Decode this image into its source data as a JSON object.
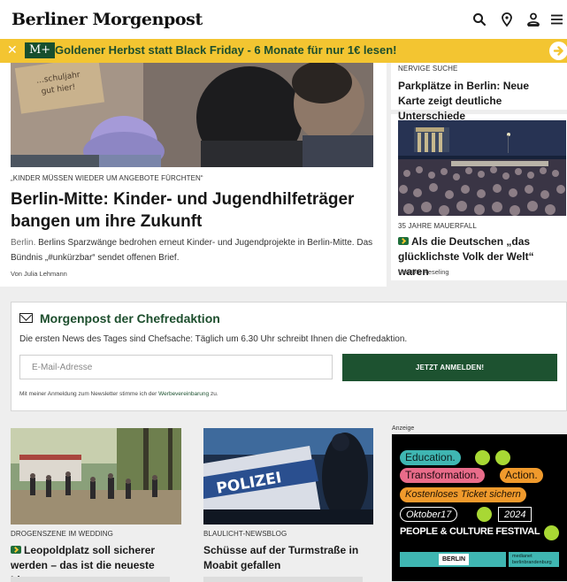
{
  "header": {
    "brand": "Berliner Morgenpost",
    "icons": [
      "search-icon",
      "location-pin-icon",
      "user-icon",
      "menu-icon"
    ]
  },
  "promo": {
    "badge": "M+",
    "text": "Goldener Herbst statt Black Friday - 6 Monate für nur 1€ lesen!",
    "close_icon": "close-icon",
    "arrow_icon": "arrow-right-icon"
  },
  "lead": {
    "kicker": "„KINDER MÜSSEN WIEDER UM ANGEBOTE FÜRCHTEN“",
    "title": "Berlin-Mitte: Kinder- und Jugendhilfeträger bangen um ihre Zukunft",
    "location": "Berlin.",
    "teaser": "Berlins Sparzwänge bedrohen erneut Kinder- und Jugendprojekte in Berlin-Mitte. Das Bündnis „#unkürzbar“ sendet offenen Brief.",
    "byline": "Von Julia Lehmann"
  },
  "side": [
    {
      "kicker": "NERVIGE SUCHE",
      "title": "Parkplätze in Berlin: Neue Karte zeigt deutliche Unterschiede",
      "plus": false,
      "byline": ""
    },
    {
      "kicker": "35 JAHRE MAUERFALL",
      "title": "Als die Deutschen „das glücklichste Volk der Welt“ waren",
      "plus": true,
      "byline": "Von Uta Keseling"
    }
  ],
  "newsletter": {
    "title": "Morgenpost der Chefredaktion",
    "description": "Die ersten News des Tages sind Chefsache: Täglich um 6.30 Uhr schreibt Ihnen die Chefredaktion.",
    "email_placeholder": "E-Mail-Adresse",
    "button": "JETZT ANMELDEN!",
    "legal_prefix": "Mit meiner Anmeldung zum Newsletter stimme ich der",
    "legal_link": "Werbevereinbarung",
    "legal_suffix": "zu."
  },
  "bottom": [
    {
      "kicker": "DROGENSZENE IM WEDDING",
      "title": "Leopoldplatz soll sicherer werden – das ist die neueste Idee",
      "plus": true
    },
    {
      "kicker": "BLAULICHT-NEWSBLOG",
      "title": "Schüsse auf der Turmstraße in Moabit gefallen",
      "plus": false
    }
  ],
  "ad": {
    "label": "Anzeige",
    "lines": [
      "Education.",
      "Transformation.",
      "Action.",
      "Kostenloses Ticket sichern",
      "Oktober17",
      "2024"
    ],
    "festival": "PEOPLE & CULTURE FESTIVAL",
    "footer_left": "BERLIN",
    "footer_right_1": "medianet",
    "footer_right_2": "berlinbrandenburg"
  },
  "colors": {
    "brand_green": "#1d5230",
    "promo_yellow": "#f3c531",
    "ad_teal": "#3fb6b2",
    "ad_pink": "#e96c8a",
    "ad_orange": "#f09a2c",
    "ad_lime": "#a8d834"
  }
}
